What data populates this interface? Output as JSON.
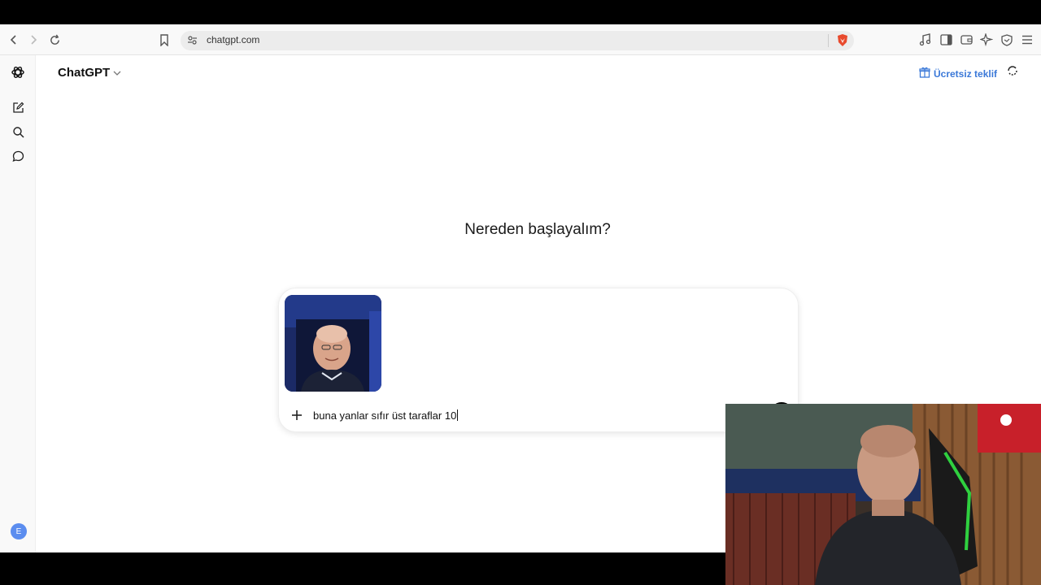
{
  "browser": {
    "url": "chatgpt.com"
  },
  "app": {
    "model_name": "ChatGPT",
    "upgrade_label": "Ücretsiz teklif",
    "heading": "Nereden başlayalım?",
    "avatar_initial": "E"
  },
  "composer": {
    "prompt_text": "buna yanlar sıfır üst taraflar 10",
    "attachment": "image"
  },
  "colors": {
    "accent": "#3a78d8",
    "send_button": "#000000",
    "brave_shield": "#e8492c",
    "avatar": "#5b8def"
  },
  "icons": [
    "back-icon",
    "forward-icon",
    "reload-icon",
    "bookmark-icon",
    "site-settings-icon",
    "brave-shield-icon",
    "media-icon",
    "sidebar-icon",
    "wallet-icon",
    "leo-ai-icon",
    "vpn-icon",
    "menu-icon",
    "openai-logo-icon",
    "new-chat-icon",
    "search-icon",
    "chat-icon",
    "gift-icon",
    "temporary-chat-icon",
    "plus-icon",
    "mic-icon",
    "arrow-up-icon"
  ]
}
